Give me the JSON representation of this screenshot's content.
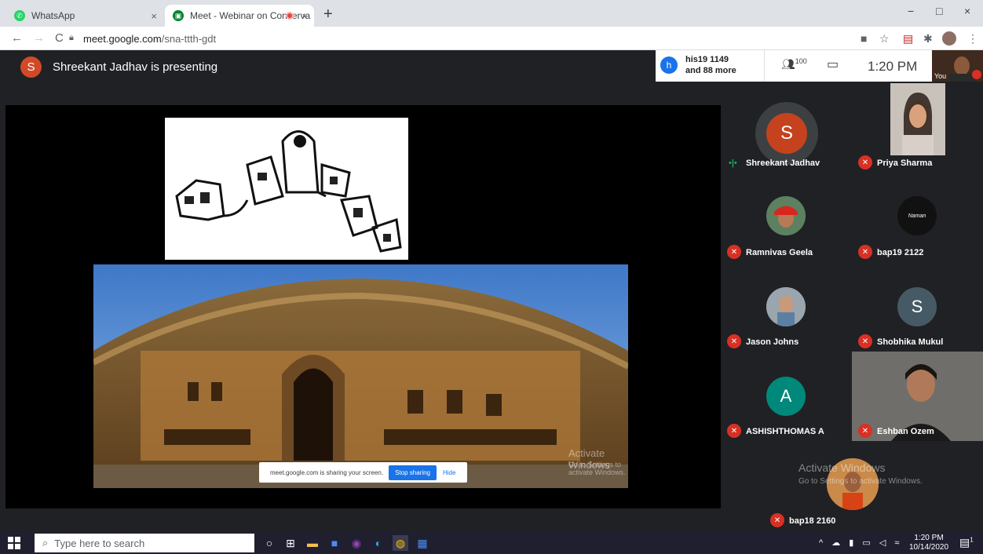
{
  "browser": {
    "tabs": [
      {
        "label": "WhatsApp",
        "close": "×"
      },
      {
        "label": "Meet - Webinar on Conserva",
        "close": "×"
      }
    ],
    "new_tab": "+",
    "window_controls": {
      "minimize": "−",
      "maximize": "□",
      "close": "×"
    },
    "nav": {
      "back": "←",
      "forward": "→",
      "reload": "C"
    },
    "url_host": "meet.google.com",
    "url_path": "/sna-ttth-gdt"
  },
  "meet": {
    "presenter_initial": "S",
    "presenting_text": "Shreekant Jadhav is presenting",
    "participants_box": {
      "initial": "h",
      "line1": "his19 1149",
      "line2": "and 88 more"
    },
    "participant_count": "100",
    "time": "1:20 PM",
    "self_label": "You",
    "share_bar": {
      "text": "meet.google.com is sharing your screen.",
      "stop": "Stop sharing",
      "hide": "Hide"
    },
    "activate_windows": {
      "title": "Activate Windows",
      "subtitle": "Go to Settings to activate Windows."
    },
    "tiles": [
      {
        "name": "Shreekant Jadhav",
        "initial": "S",
        "color": "#c5421e",
        "speaking": true
      },
      {
        "name": "Priya Sharma",
        "initial": "",
        "color": "#6b6f76",
        "speaking": false
      },
      {
        "name": "Ramnivas Geela",
        "initial": "",
        "color": "#3a5f80",
        "speaking": false
      },
      {
        "name": "bap19 2122",
        "initial": "Naman",
        "color": "#111111",
        "speaking": false
      },
      {
        "name": "Jason Johns",
        "initial": "",
        "color": "#7a8b96",
        "speaking": false
      },
      {
        "name": "Shobhika Mukul",
        "initial": "S",
        "color": "#455a64",
        "speaking": false
      },
      {
        "name": "ASHISHTHOMAS A",
        "initial": "A",
        "color": "#00897b",
        "speaking": false
      },
      {
        "name": "Eshban Ozem",
        "initial": "",
        "color": "#4a4b4d",
        "speaking": false
      },
      {
        "name": "bap18 2160",
        "initial": "",
        "color": "#b5642a",
        "speaking": false
      }
    ]
  },
  "taskbar": {
    "search_placeholder": "Type here to search",
    "clock_time": "1:20 PM",
    "clock_date": "10/14/2020",
    "notification_count": "1"
  }
}
